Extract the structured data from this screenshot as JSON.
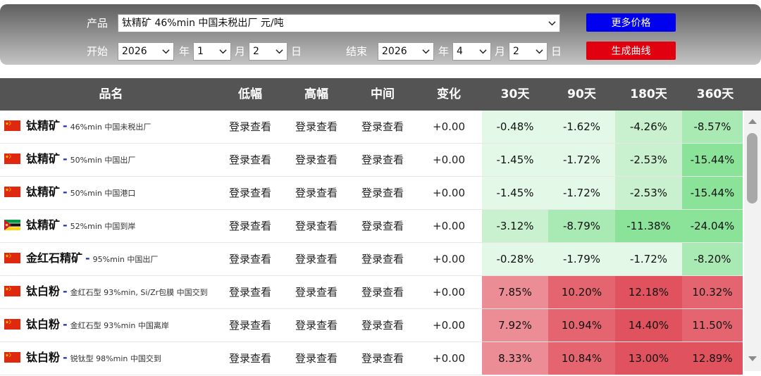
{
  "filter": {
    "product_label": "产品",
    "product_value": "钛精矿  46%min 中国未税出厂 元/吨",
    "start_label": "开始",
    "end_label": "结束",
    "start": {
      "year": "2026",
      "month": "1",
      "day": "2"
    },
    "end": {
      "year": "2026",
      "month": "4",
      "day": "2"
    },
    "year_unit": "年",
    "month_unit": "月",
    "day_unit": "日",
    "more_price_button": "更多价格",
    "generate_curve_button": "生成曲线",
    "colors": {
      "more_price_bg": "#0000ee",
      "generate_bg": "#e00010"
    }
  },
  "table": {
    "headers": [
      "品名",
      "低幅",
      "高幅",
      "中间",
      "变化",
      "30天",
      "90天",
      "180天",
      "360天"
    ],
    "rows": [
      {
        "name": "钛精矿",
        "spec": "46%min 中国未税出厂",
        "flag": "china-flag-icon",
        "low": "登录查看",
        "high": "登录查看",
        "mid": "登录查看",
        "change": "+0.00",
        "d30": "-0.48%",
        "d90": "-1.62%",
        "d180": "-4.26%",
        "d360": "-8.57%"
      },
      {
        "name": "钛精矿",
        "spec": "50%min 中国出厂",
        "flag": "china-flag-icon",
        "low": "登录查看",
        "high": "登录查看",
        "mid": "登录查看",
        "change": "+0.00",
        "d30": "-1.45%",
        "d90": "-1.72%",
        "d180": "-2.53%",
        "d360": "-15.44%"
      },
      {
        "name": "钛精矿",
        "spec": "50%min 中国港口",
        "flag": "china-flag-icon",
        "low": "登录查看",
        "high": "登录查看",
        "mid": "登录查看",
        "change": "+0.00",
        "d30": "-1.45%",
        "d90": "-1.72%",
        "d180": "-2.53%",
        "d360": "-15.44%"
      },
      {
        "name": "钛精矿",
        "spec": "52%min 中国到岸",
        "flag": "mozambique-flag-icon",
        "low": "登录查看",
        "high": "登录查看",
        "mid": "登录查看",
        "change": "+0.00",
        "d30": "-3.12%",
        "d90": "-8.79%",
        "d180": "-11.38%",
        "d360": "-24.04%"
      },
      {
        "name": "金红石精矿",
        "spec": "95%min 中国出厂",
        "flag": "china-flag-icon",
        "low": "登录查看",
        "high": "登录查看",
        "mid": "登录查看",
        "change": "+0.00",
        "d30": "-0.28%",
        "d90": "-1.79%",
        "d180": "-1.72%",
        "d360": "-8.20%"
      },
      {
        "name": "钛白粉",
        "spec": "金红石型 93%min, Si/Zr包膜 中国交到",
        "flag": "china-flag-icon",
        "low": "登录查看",
        "high": "登录查看",
        "mid": "登录查看",
        "change": "+0.00",
        "d30": "7.85%",
        "d90": "10.20%",
        "d180": "12.18%",
        "d360": "10.32%"
      },
      {
        "name": "钛白粉",
        "spec": "金红石型 93%min 中国离岸",
        "flag": "china-flag-icon",
        "low": "登录查看",
        "high": "登录查看",
        "mid": "登录查看",
        "change": "+0.00",
        "d30": "7.92%",
        "d90": "10.94%",
        "d180": "14.40%",
        "d360": "11.50%"
      },
      {
        "name": "钛白粉",
        "spec": "锐钛型 98%min 中国交到",
        "flag": "china-flag-icon",
        "low": "登录查看",
        "high": "登录查看",
        "mid": "登录查看",
        "change": "+0.00",
        "d30": "8.33%",
        "d90": "10.84%",
        "d180": "13.00%",
        "d360": "12.89%"
      }
    ]
  },
  "colors": {
    "header_bg": "#545454",
    "negative_shades": [
      "#e3f8e6",
      "#c9f1cf",
      "#a9e9b4",
      "#8be39a"
    ],
    "positive_shades": [
      "#ec8c94",
      "#e4656f",
      "#df525e"
    ]
  }
}
